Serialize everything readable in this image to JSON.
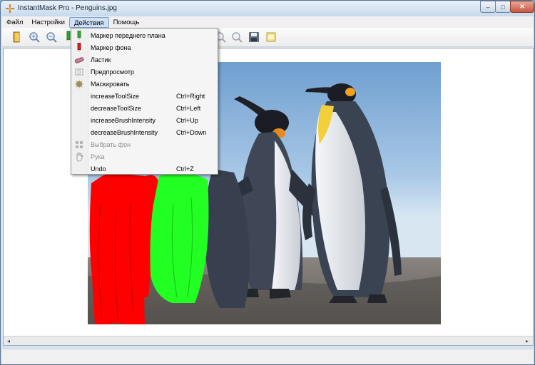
{
  "window": {
    "title": "InstantMask Pro - Penguins.jpg",
    "controls": {
      "minimize": "–",
      "maximize": "□",
      "close": "✕"
    }
  },
  "menubar": {
    "items": [
      {
        "label": "Файл"
      },
      {
        "label": "Настройки"
      },
      {
        "label": "Действия",
        "active": true
      },
      {
        "label": "Помощь"
      }
    ]
  },
  "toolbar": {
    "buttons": [
      "open-folder-icon",
      "zoom-in-icon",
      "zoom-out-icon",
      "foreground-marker-icon",
      "zoom-in-icon",
      "zoom-out-icon",
      "save-icon",
      "export-icon"
    ]
  },
  "actions_menu": {
    "items": [
      {
        "label": "Маркер переднего плана",
        "shortcut": "",
        "icon": "green-marker-icon",
        "enabled": true
      },
      {
        "label": "Маркер фона",
        "shortcut": "",
        "icon": "red-marker-icon",
        "enabled": true
      },
      {
        "label": "Ластик",
        "shortcut": "",
        "icon": "eraser-icon",
        "enabled": true
      },
      {
        "label": "Предпросмотр",
        "shortcut": "",
        "icon": "preview-icon",
        "enabled": true
      },
      {
        "label": "Маскировать",
        "shortcut": "",
        "icon": "mask-icon",
        "enabled": true
      },
      {
        "label": "increaseToolSize",
        "shortcut": "Ctrl+Right",
        "icon": "",
        "enabled": true
      },
      {
        "label": "decreaseToolSize",
        "shortcut": "Ctrl+Left",
        "icon": "",
        "enabled": true
      },
      {
        "label": "increaseBrushIntensity",
        "shortcut": "Ctrl+Up",
        "icon": "",
        "enabled": true
      },
      {
        "label": "decreaseBrushIntensity",
        "shortcut": "Ctrl+Down",
        "icon": "",
        "enabled": true
      },
      {
        "label": "Выбрать фон",
        "shortcut": "",
        "icon": "select-background-icon",
        "enabled": false
      },
      {
        "label": "Рука",
        "shortcut": "",
        "icon": "hand-icon",
        "enabled": false
      },
      {
        "label": "Undo",
        "shortcut": "Ctrl+Z",
        "icon": "",
        "enabled": true
      }
    ]
  },
  "canvas": {
    "image": "penguins-photo",
    "colors": {
      "background_marker": "#ff0000",
      "foreground_marker": "#22ff22",
      "sky": "#8db8de",
      "sand": "#6f6a66"
    }
  },
  "scrollbar": {
    "left_arrow": "◂",
    "right_arrow": "▸"
  }
}
